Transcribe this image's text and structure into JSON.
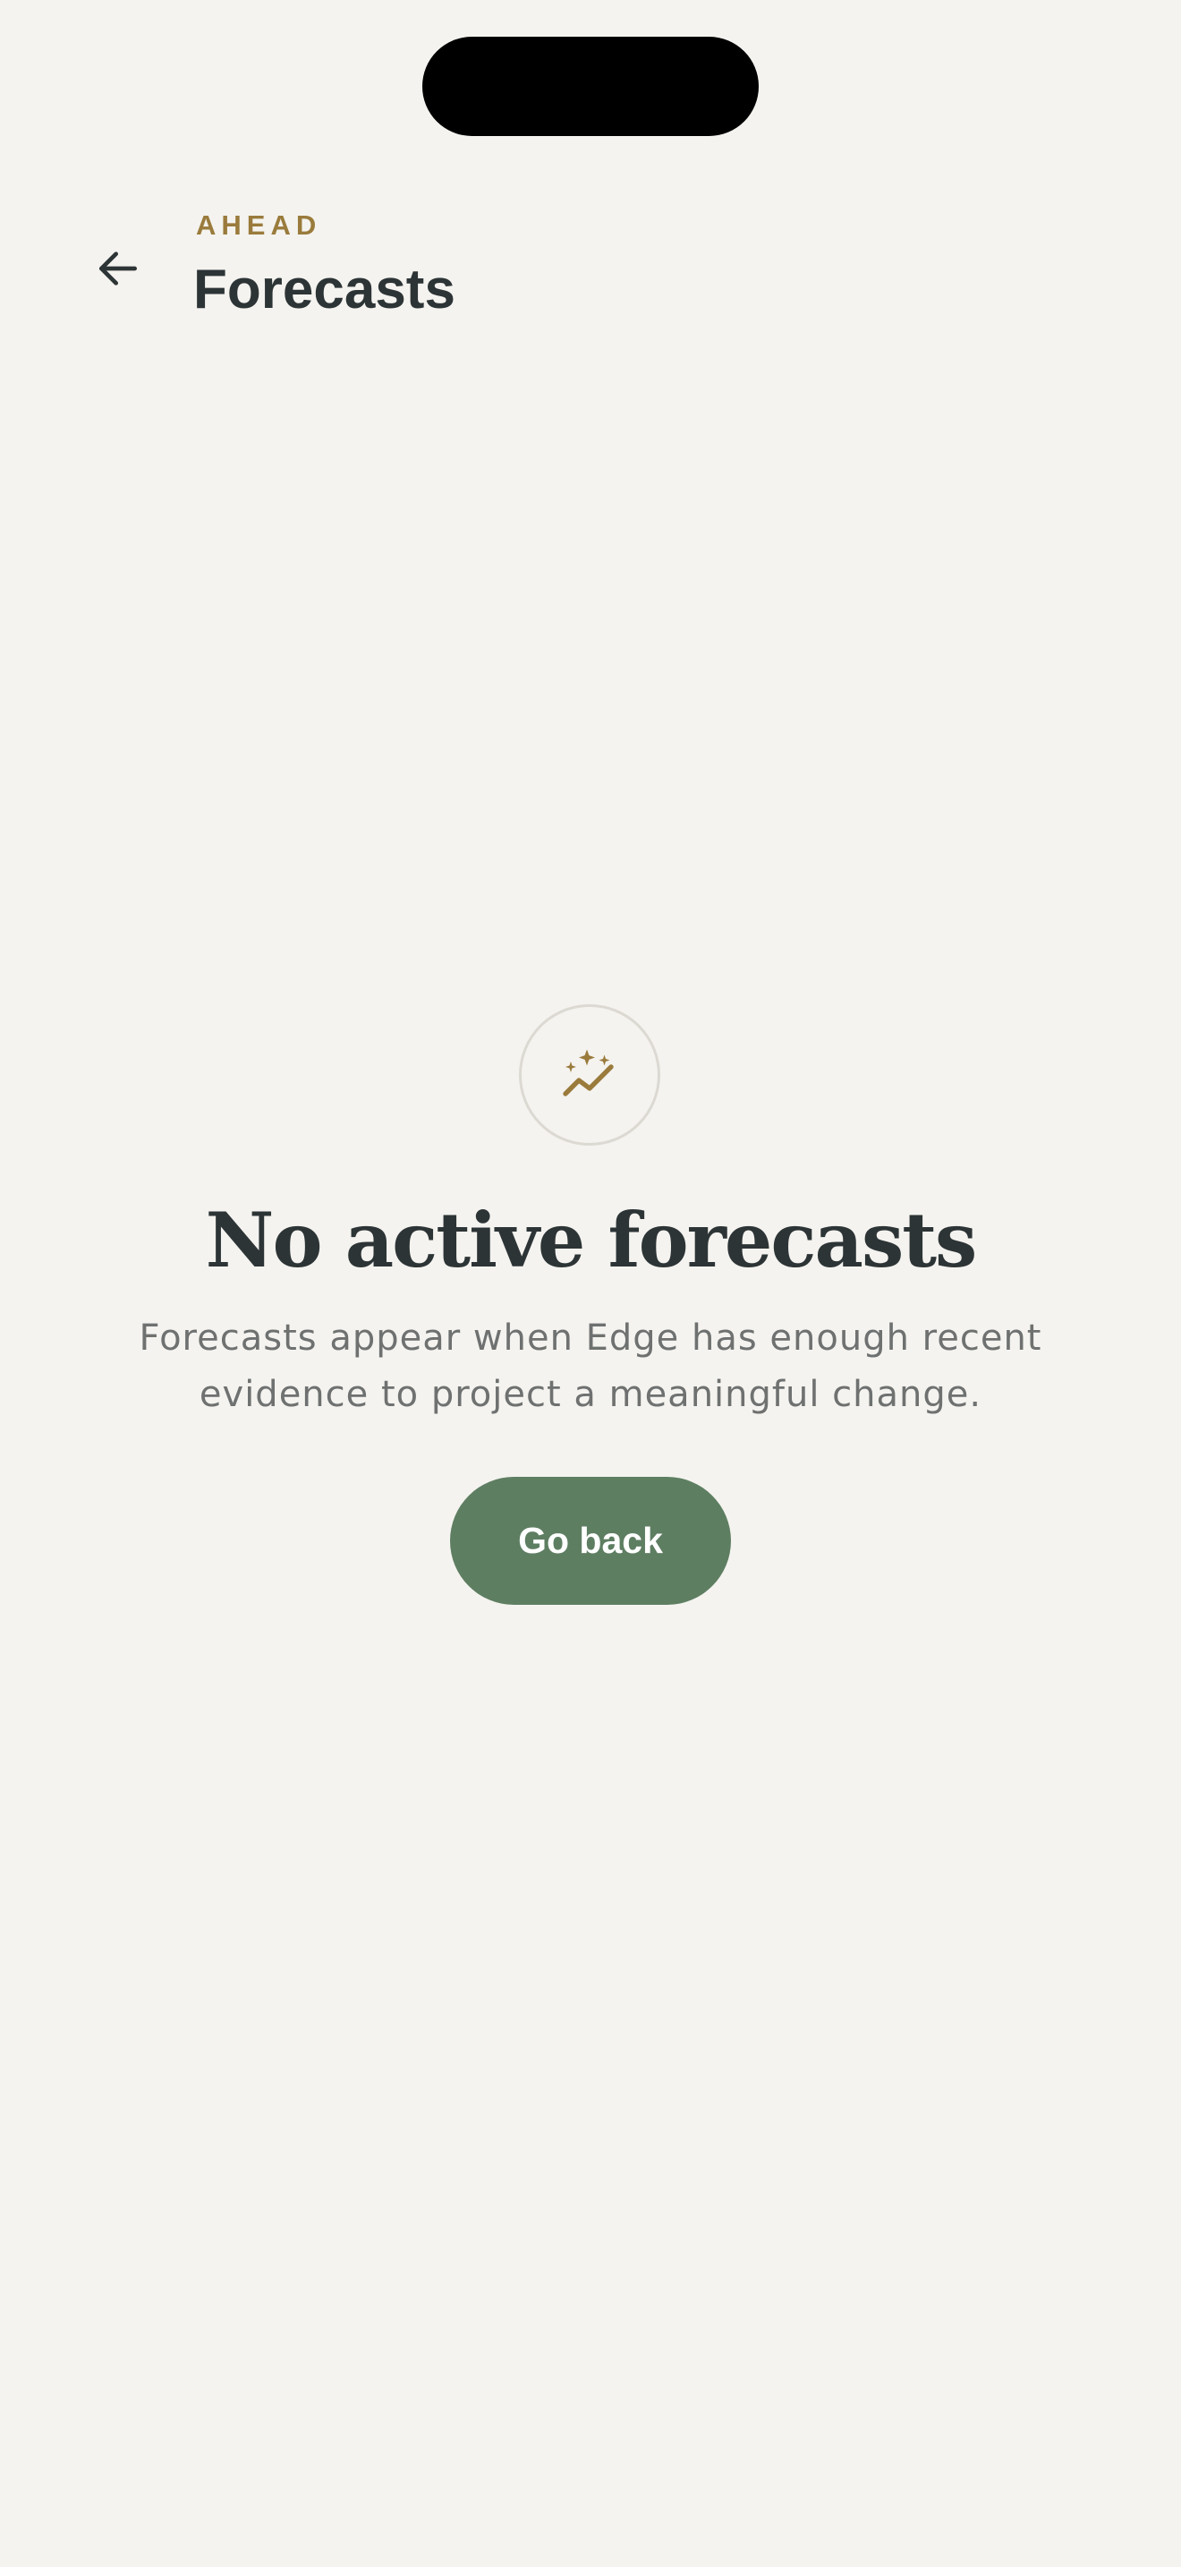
{
  "header": {
    "eyebrow": "AHEAD",
    "title": "Forecasts"
  },
  "empty_state": {
    "icon": "sparkle-trend-icon",
    "title": "No active forecasts",
    "description": "Forecasts appear when Edge has enough recent evidence to project a meaningful change.",
    "button_label": "Go back"
  },
  "colors": {
    "background": "#f4f3ef",
    "accent_gold": "#9a7b3c",
    "text_dark": "#2d3436",
    "text_muted": "#6e7170",
    "button_green": "#5e7e62"
  }
}
